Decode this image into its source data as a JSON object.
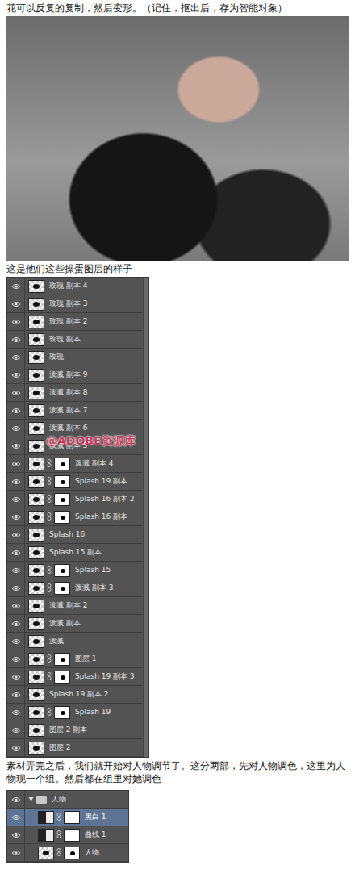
{
  "caption_1": "花可以反复的复制，然后变形。（记住，抠出后，存为智能对象）",
  "caption_2": "这是他们这些操蛋图层的样子",
  "layers_panel": {
    "watermark": "@ADOBE资源库",
    "layers": [
      {
        "name": "玫瑰 副本 4",
        "kind": "plain",
        "visible": true
      },
      {
        "name": "玫瑰 副本 3",
        "kind": "plain",
        "visible": true
      },
      {
        "name": "玫瑰 副本 2",
        "kind": "plain",
        "visible": true
      },
      {
        "name": "玫瑰 副本",
        "kind": "plain",
        "visible": true
      },
      {
        "name": "玫瑰",
        "kind": "plain",
        "visible": true
      },
      {
        "name": "泼溅 副本 9",
        "kind": "plain",
        "visible": true
      },
      {
        "name": "泼溅 副本 8",
        "kind": "plain",
        "visible": true
      },
      {
        "name": "泼溅 副本 7",
        "kind": "plain",
        "visible": true
      },
      {
        "name": "泼溅 副本 6",
        "kind": "plain",
        "visible": true
      },
      {
        "name": "泼溅 副本 5",
        "kind": "plain",
        "visible": true
      },
      {
        "name": "泼溅 副本 4",
        "kind": "mask",
        "visible": true
      },
      {
        "name": "Splash 19 副本",
        "kind": "mask",
        "visible": true
      },
      {
        "name": "Splash 16 副本 2",
        "kind": "mask",
        "visible": true
      },
      {
        "name": "Splash 16 副本",
        "kind": "mask",
        "visible": true
      },
      {
        "name": "Splash 16",
        "kind": "plain",
        "visible": true
      },
      {
        "name": "Splash 15 副本",
        "kind": "plain",
        "visible": true
      },
      {
        "name": "Splash 15",
        "kind": "mask",
        "visible": true
      },
      {
        "name": "泼溅 副本 3",
        "kind": "mask",
        "visible": true
      },
      {
        "name": "泼溅 副本 2",
        "kind": "plain",
        "visible": true
      },
      {
        "name": "泼溅 副本",
        "kind": "plain",
        "visible": true
      },
      {
        "name": "泼溅",
        "kind": "plain",
        "visible": true
      },
      {
        "name": "图层 1",
        "kind": "mask",
        "visible": true
      },
      {
        "name": "Splash 19 副本 3",
        "kind": "mask",
        "visible": true
      },
      {
        "name": "Splash 19 副本 2",
        "kind": "plain",
        "visible": true
      },
      {
        "name": "Splash 19",
        "kind": "mask",
        "visible": true
      },
      {
        "name": "图层 2 副本",
        "kind": "plain",
        "visible": true
      },
      {
        "name": "图层 2",
        "kind": "plain",
        "visible": true
      }
    ]
  },
  "caption_3": "素材弄完之后，我们就开始对人物调节了。这分两部，先对人物调色，这里为人物现一个组。然后都在组里对她调色",
  "group_panel": {
    "group": {
      "name": "人物",
      "expanded": true,
      "visible": true
    },
    "layers": [
      {
        "name": "黑白 1",
        "kind": "adjustment",
        "selected": true,
        "visible": true
      },
      {
        "name": "曲线 1",
        "kind": "adjustment",
        "selected": false,
        "visible": true
      },
      {
        "name": "人物",
        "kind": "mask",
        "selected": false,
        "visible": true
      }
    ]
  }
}
